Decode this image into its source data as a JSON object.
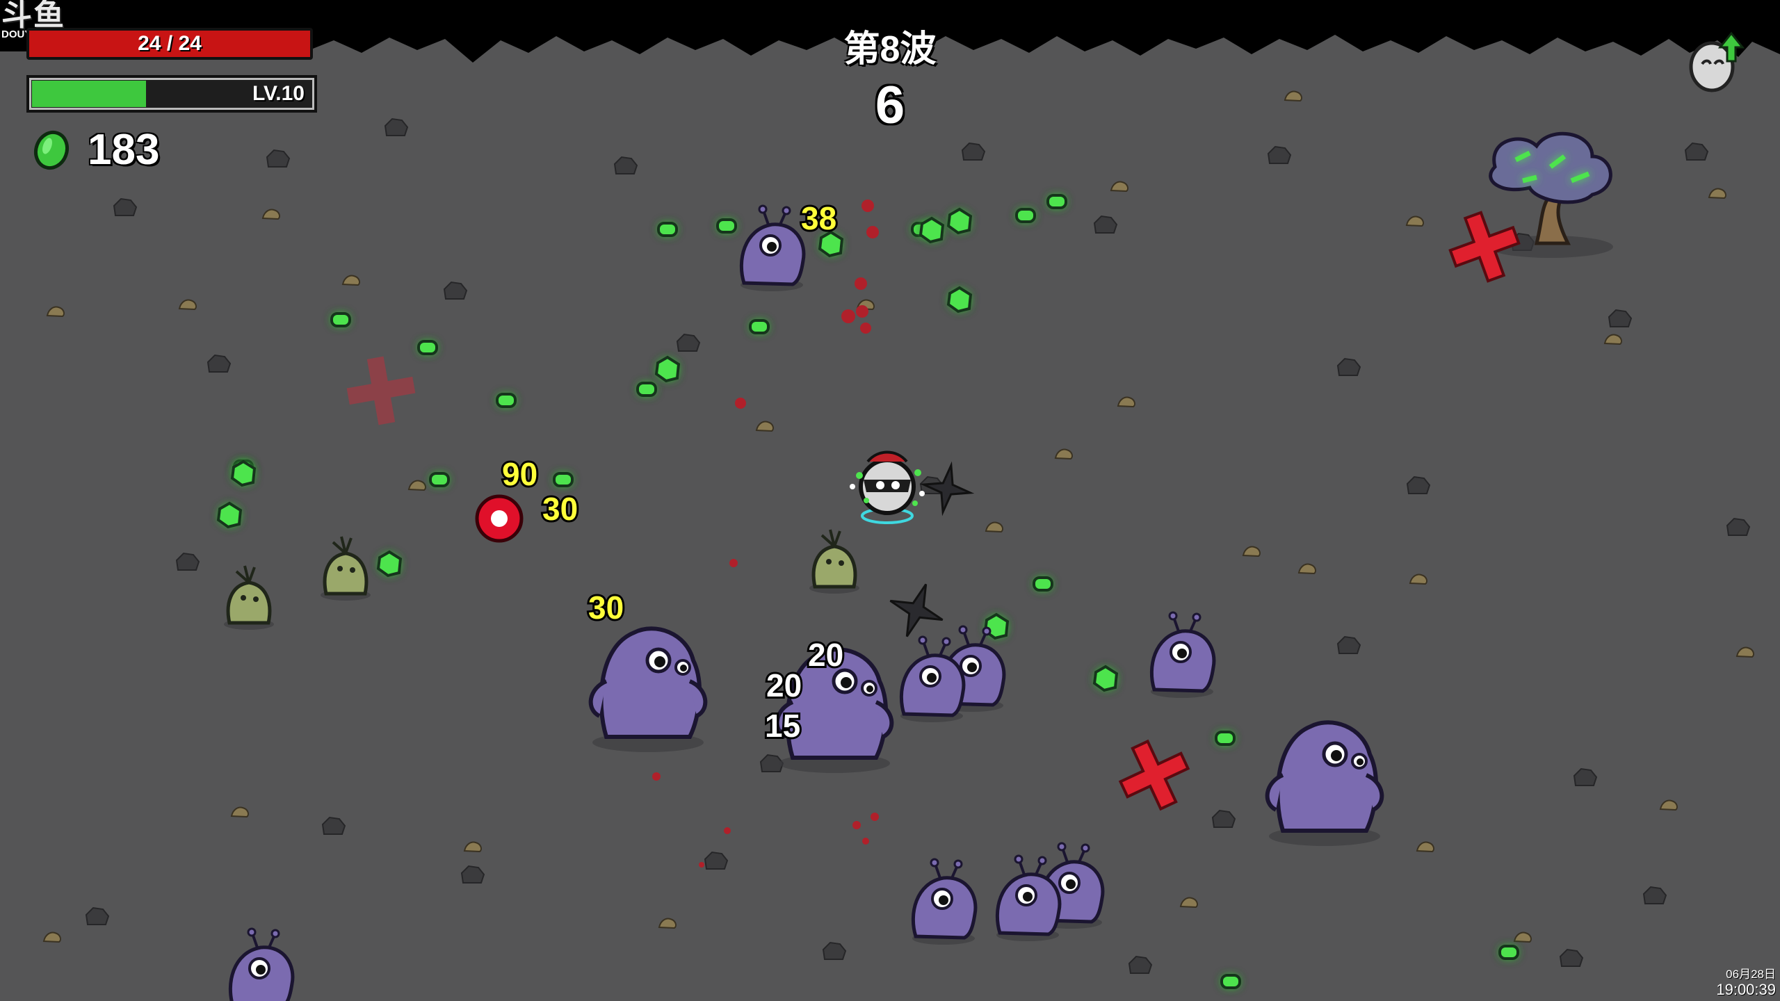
{
  "watermark": {
    "logo": "斗鱼",
    "site": "DOUYU.COM"
  },
  "player": {
    "hp_text": "24 / 24",
    "hp_current": 24,
    "hp_max": 24,
    "level_text": "LV.10",
    "xp_fraction": 0.42,
    "materials": "183"
  },
  "wave": {
    "title": "第8波",
    "timer": "6"
  },
  "clock": {
    "date": "06月28日",
    "time": "19:00:39"
  },
  "damage_numbers": [
    "38",
    "90",
    "30",
    "30",
    "20",
    "20",
    "15"
  ],
  "colors": {
    "ground": "#555556",
    "hp": "#c81414",
    "xp": "#3ec83e",
    "material": "#4ee44e",
    "enemy": "#7b6bb0",
    "damage_crit": "#ffff3a",
    "damage_normal": "#ffffff"
  },
  "icons": {
    "material": "material-icon",
    "levelup": "levelup-egg-icon"
  }
}
